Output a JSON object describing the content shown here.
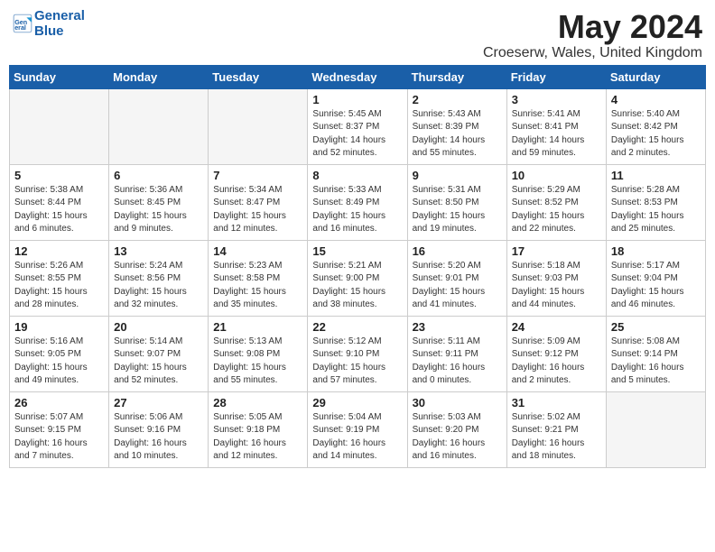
{
  "header": {
    "logo_line1": "General",
    "logo_line2": "Blue",
    "month_title": "May 2024",
    "location": "Croeserw, Wales, United Kingdom"
  },
  "weekdays": [
    "Sunday",
    "Monday",
    "Tuesday",
    "Wednesday",
    "Thursday",
    "Friday",
    "Saturday"
  ],
  "weeks": [
    [
      {
        "day": "",
        "info": ""
      },
      {
        "day": "",
        "info": ""
      },
      {
        "day": "",
        "info": ""
      },
      {
        "day": "1",
        "info": "Sunrise: 5:45 AM\nSunset: 8:37 PM\nDaylight: 14 hours and 52 minutes."
      },
      {
        "day": "2",
        "info": "Sunrise: 5:43 AM\nSunset: 8:39 PM\nDaylight: 14 hours and 55 minutes."
      },
      {
        "day": "3",
        "info": "Sunrise: 5:41 AM\nSunset: 8:41 PM\nDaylight: 14 hours and 59 minutes."
      },
      {
        "day": "4",
        "info": "Sunrise: 5:40 AM\nSunset: 8:42 PM\nDaylight: 15 hours and 2 minutes."
      }
    ],
    [
      {
        "day": "5",
        "info": "Sunrise: 5:38 AM\nSunset: 8:44 PM\nDaylight: 15 hours and 6 minutes."
      },
      {
        "day": "6",
        "info": "Sunrise: 5:36 AM\nSunset: 8:45 PM\nDaylight: 15 hours and 9 minutes."
      },
      {
        "day": "7",
        "info": "Sunrise: 5:34 AM\nSunset: 8:47 PM\nDaylight: 15 hours and 12 minutes."
      },
      {
        "day": "8",
        "info": "Sunrise: 5:33 AM\nSunset: 8:49 PM\nDaylight: 15 hours and 16 minutes."
      },
      {
        "day": "9",
        "info": "Sunrise: 5:31 AM\nSunset: 8:50 PM\nDaylight: 15 hours and 19 minutes."
      },
      {
        "day": "10",
        "info": "Sunrise: 5:29 AM\nSunset: 8:52 PM\nDaylight: 15 hours and 22 minutes."
      },
      {
        "day": "11",
        "info": "Sunrise: 5:28 AM\nSunset: 8:53 PM\nDaylight: 15 hours and 25 minutes."
      }
    ],
    [
      {
        "day": "12",
        "info": "Sunrise: 5:26 AM\nSunset: 8:55 PM\nDaylight: 15 hours and 28 minutes."
      },
      {
        "day": "13",
        "info": "Sunrise: 5:24 AM\nSunset: 8:56 PM\nDaylight: 15 hours and 32 minutes."
      },
      {
        "day": "14",
        "info": "Sunrise: 5:23 AM\nSunset: 8:58 PM\nDaylight: 15 hours and 35 minutes."
      },
      {
        "day": "15",
        "info": "Sunrise: 5:21 AM\nSunset: 9:00 PM\nDaylight: 15 hours and 38 minutes."
      },
      {
        "day": "16",
        "info": "Sunrise: 5:20 AM\nSunset: 9:01 PM\nDaylight: 15 hours and 41 minutes."
      },
      {
        "day": "17",
        "info": "Sunrise: 5:18 AM\nSunset: 9:03 PM\nDaylight: 15 hours and 44 minutes."
      },
      {
        "day": "18",
        "info": "Sunrise: 5:17 AM\nSunset: 9:04 PM\nDaylight: 15 hours and 46 minutes."
      }
    ],
    [
      {
        "day": "19",
        "info": "Sunrise: 5:16 AM\nSunset: 9:05 PM\nDaylight: 15 hours and 49 minutes."
      },
      {
        "day": "20",
        "info": "Sunrise: 5:14 AM\nSunset: 9:07 PM\nDaylight: 15 hours and 52 minutes."
      },
      {
        "day": "21",
        "info": "Sunrise: 5:13 AM\nSunset: 9:08 PM\nDaylight: 15 hours and 55 minutes."
      },
      {
        "day": "22",
        "info": "Sunrise: 5:12 AM\nSunset: 9:10 PM\nDaylight: 15 hours and 57 minutes."
      },
      {
        "day": "23",
        "info": "Sunrise: 5:11 AM\nSunset: 9:11 PM\nDaylight: 16 hours and 0 minutes."
      },
      {
        "day": "24",
        "info": "Sunrise: 5:09 AM\nSunset: 9:12 PM\nDaylight: 16 hours and 2 minutes."
      },
      {
        "day": "25",
        "info": "Sunrise: 5:08 AM\nSunset: 9:14 PM\nDaylight: 16 hours and 5 minutes."
      }
    ],
    [
      {
        "day": "26",
        "info": "Sunrise: 5:07 AM\nSunset: 9:15 PM\nDaylight: 16 hours and 7 minutes."
      },
      {
        "day": "27",
        "info": "Sunrise: 5:06 AM\nSunset: 9:16 PM\nDaylight: 16 hours and 10 minutes."
      },
      {
        "day": "28",
        "info": "Sunrise: 5:05 AM\nSunset: 9:18 PM\nDaylight: 16 hours and 12 minutes."
      },
      {
        "day": "29",
        "info": "Sunrise: 5:04 AM\nSunset: 9:19 PM\nDaylight: 16 hours and 14 minutes."
      },
      {
        "day": "30",
        "info": "Sunrise: 5:03 AM\nSunset: 9:20 PM\nDaylight: 16 hours and 16 minutes."
      },
      {
        "day": "31",
        "info": "Sunrise: 5:02 AM\nSunset: 9:21 PM\nDaylight: 16 hours and 18 minutes."
      },
      {
        "day": "",
        "info": ""
      }
    ]
  ]
}
